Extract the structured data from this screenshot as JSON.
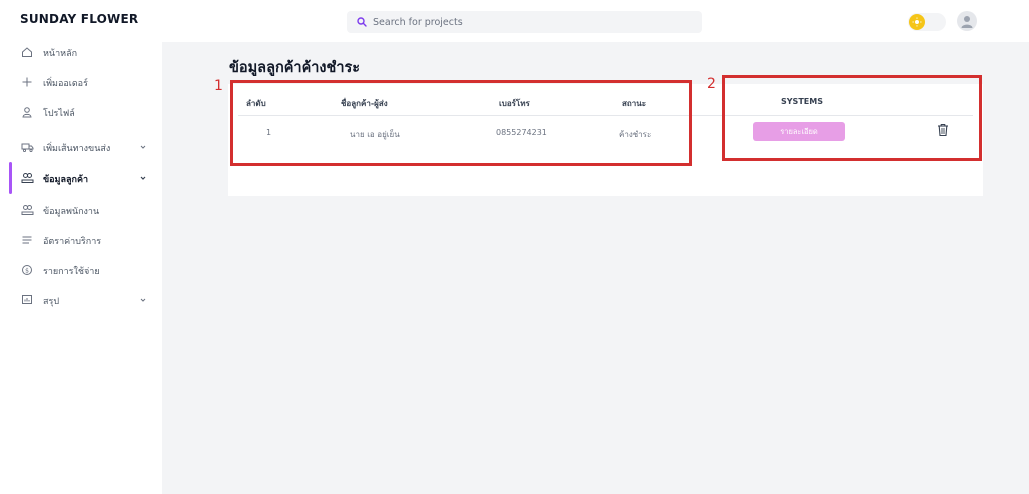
{
  "brand": "SUNDAY FLOWER",
  "search": {
    "placeholder": "Search for projects"
  },
  "sidebar": {
    "items": [
      {
        "label": "หน้าหลัก"
      },
      {
        "label": "เพิ่มออเดอร์"
      },
      {
        "label": "โปรไฟล์"
      },
      {
        "label": "เพิ่มเส้นทางขนส่ง"
      },
      {
        "label": "ข้อมูลลูกค้า"
      },
      {
        "label": "ข้อมูลพนักงาน"
      },
      {
        "label": "อัตราค่าบริการ"
      },
      {
        "label": "รายการใช้จ่าย"
      },
      {
        "label": "สรุป"
      }
    ]
  },
  "page": {
    "title": "ข้อมูลลูกค้าค้างชำระ"
  },
  "table": {
    "headers": [
      "ลำดับ",
      "ชื่อลูกค้า-ผู้ส่ง",
      "เบอร์โทร",
      "สถานะ",
      "SYSTEMS"
    ],
    "rows": [
      {
        "no": "1",
        "name": "นาย เอ อยู่เย็น",
        "phone": "0855274231",
        "status": "ค้างชำระ",
        "action": "รายละเอียด"
      }
    ]
  },
  "annotations": {
    "one": "1",
    "two": "2"
  },
  "colors": {
    "accent": "#a855f7",
    "detail_button": "#e79ee6",
    "highlight": "#d32f2f",
    "toggle": "#f5c518"
  }
}
